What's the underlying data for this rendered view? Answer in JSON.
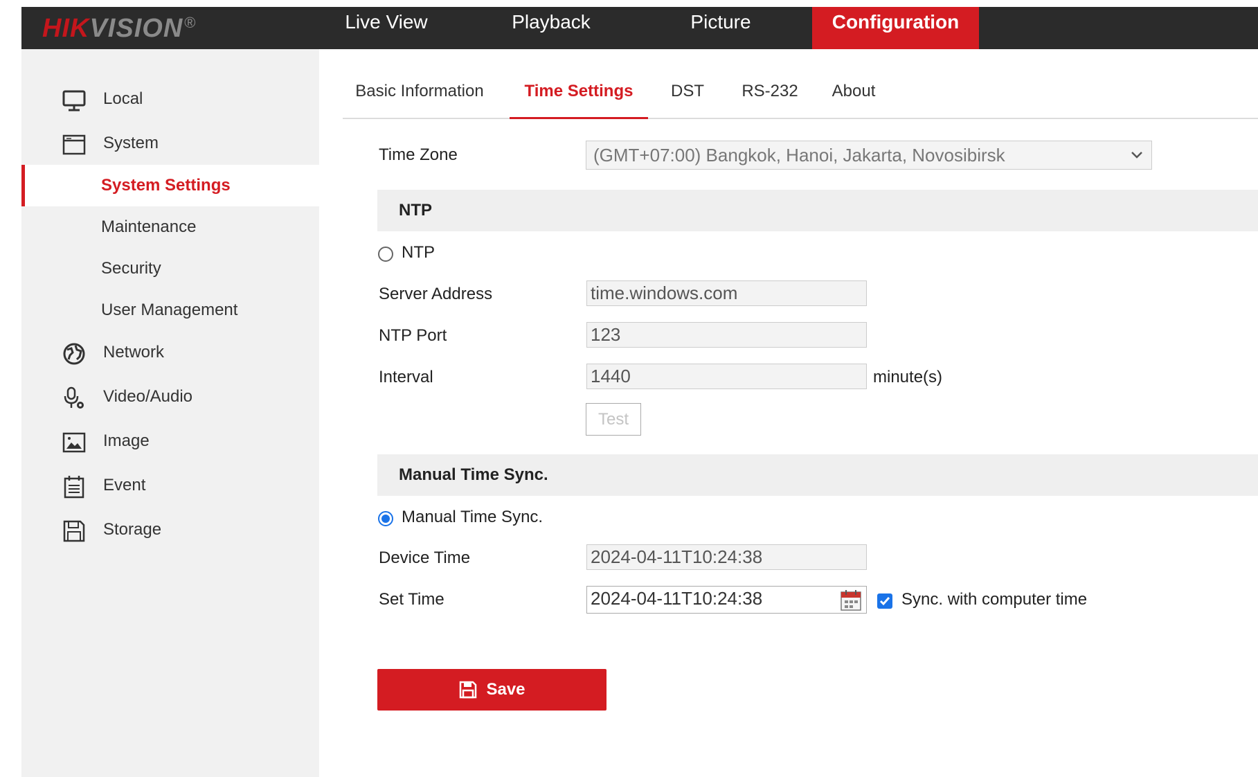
{
  "header": {
    "logo_text_red": "HIK",
    "logo_text_gray": "VISION",
    "logo_reg": "®",
    "nav": [
      {
        "label": "Live View"
      },
      {
        "label": "Playback"
      },
      {
        "label": "Picture"
      },
      {
        "label": "Configuration",
        "active": true
      }
    ]
  },
  "sidebar": {
    "items": [
      {
        "label": "Local",
        "icon": "monitor-icon"
      },
      {
        "label": "System",
        "icon": "window-icon"
      },
      {
        "label": "System Settings",
        "active": true
      },
      {
        "label": "Maintenance"
      },
      {
        "label": "Security"
      },
      {
        "label": "User Management"
      },
      {
        "label": "Network",
        "icon": "globe-icon"
      },
      {
        "label": "Video/Audio",
        "icon": "microphone-icon"
      },
      {
        "label": "Image",
        "icon": "image-icon"
      },
      {
        "label": "Event",
        "icon": "calendar-icon"
      },
      {
        "label": "Storage",
        "icon": "floppy-disk-icon"
      }
    ]
  },
  "tabs": [
    {
      "label": "Basic Information"
    },
    {
      "label": "Time Settings",
      "active": true
    },
    {
      "label": "DST"
    },
    {
      "label": "RS-232"
    },
    {
      "label": "About"
    }
  ],
  "form": {
    "time_zone_label": "Time Zone",
    "time_zone_value": "(GMT+07:00) Bangkok, Hanoi, Jakarta, Novosibirsk",
    "ntp_section": "NTP",
    "ntp_radio_label": "NTP",
    "ntp_selected": false,
    "server_address_label": "Server Address",
    "server_address_value": "time.windows.com",
    "ntp_port_label": "NTP Port",
    "ntp_port_value": "123",
    "interval_label": "Interval",
    "interval_value": "1440",
    "interval_unit": "minute(s)",
    "test_button": "Test",
    "manual_section": "Manual Time Sync.",
    "manual_radio_label": "Manual Time Sync.",
    "manual_selected": true,
    "device_time_label": "Device Time",
    "device_time_value": "2024-04-11T10:24:38",
    "set_time_label": "Set Time",
    "set_time_value": "2024-04-11T10:24:38",
    "sync_checkbox_label": "Sync. with computer time",
    "sync_checked": true,
    "save_button": "Save"
  },
  "colors": {
    "accent": "#d41c22",
    "topbar": "#2b2b2b",
    "sidebar_bg": "#f1f1f1",
    "radio_checked": "#1a73e8"
  }
}
